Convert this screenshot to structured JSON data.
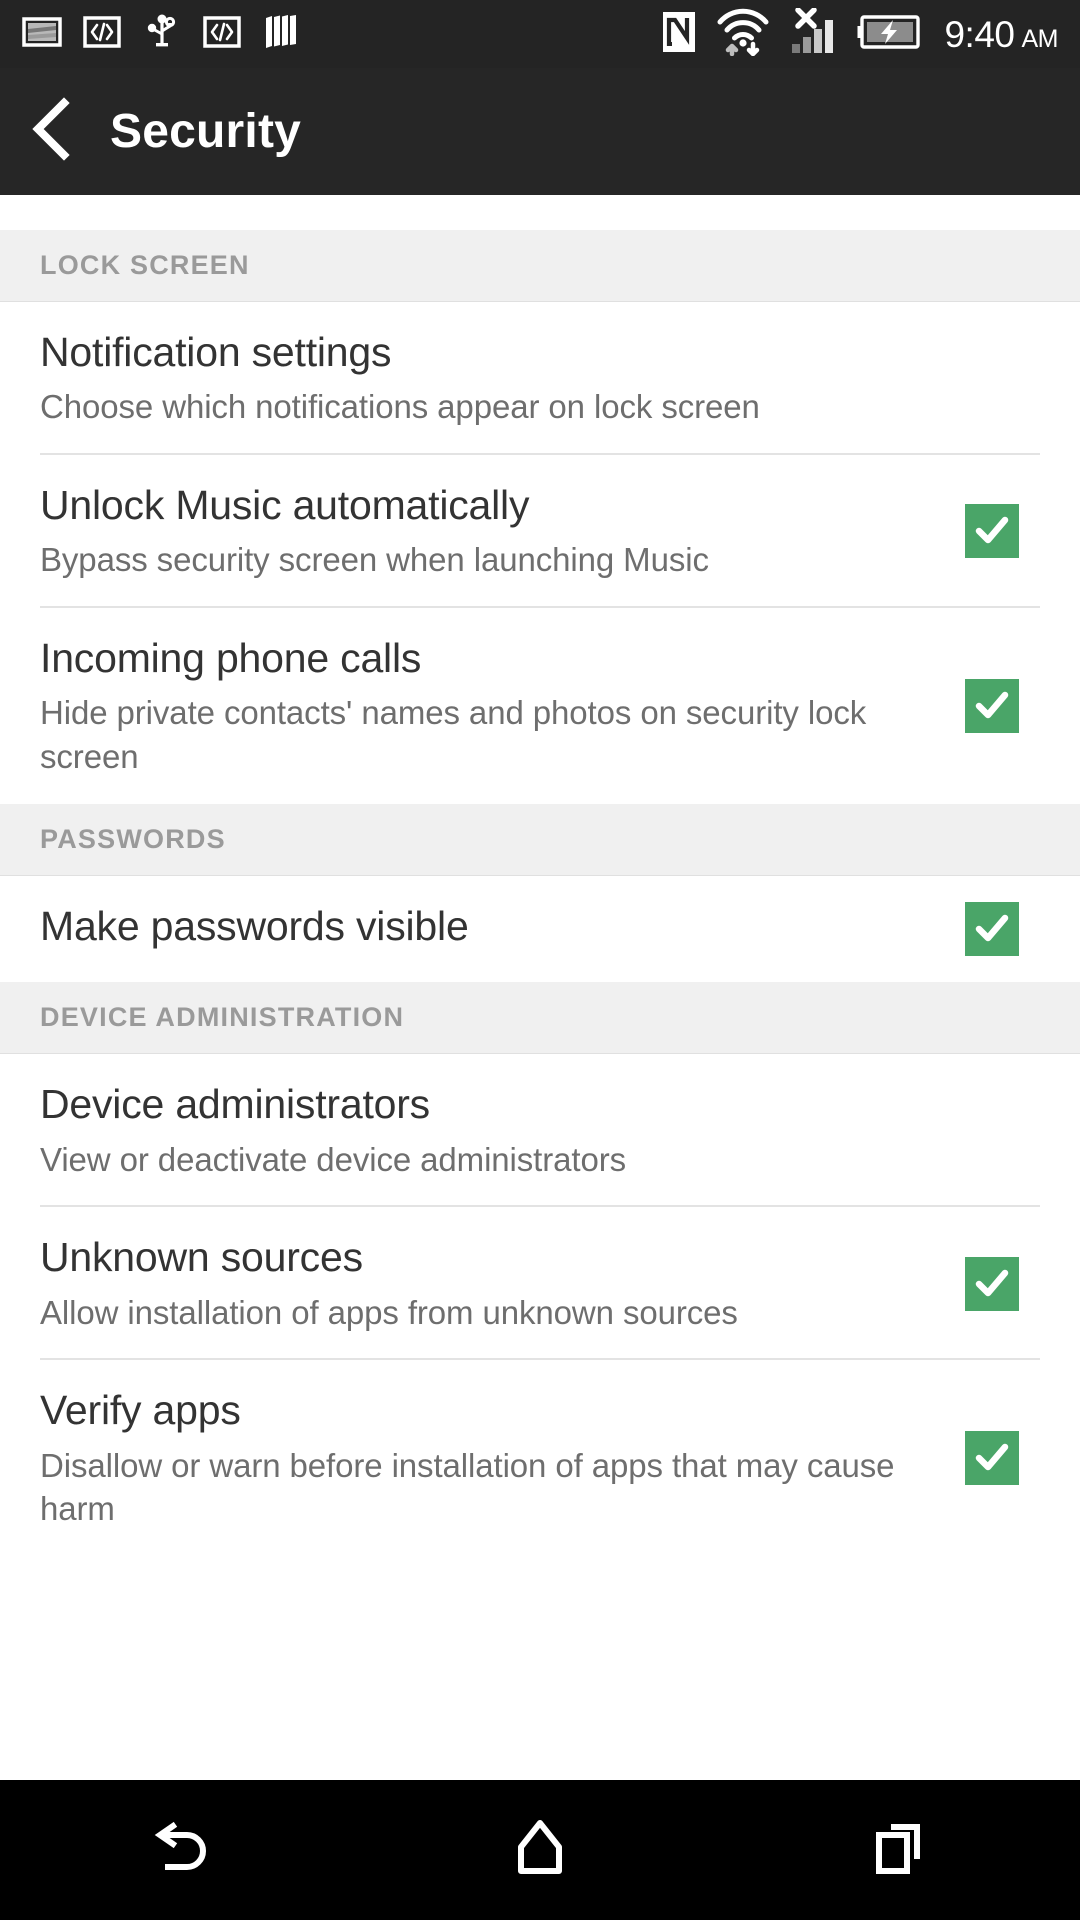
{
  "status_bar": {
    "left_icons": [
      "screenshot-icon",
      "code-brackets-icon",
      "usb-icon",
      "code-brackets-icon-2",
      "columns-icon"
    ],
    "right_icons": [
      "nfc-icon",
      "wifi-transfer-icon",
      "signal-no-service-icon",
      "battery-charging-icon"
    ],
    "time": "9:40",
    "ampm": "AM"
  },
  "action_bar": {
    "back_icon": "back-chevron-icon",
    "title": "Security"
  },
  "colors": {
    "checkbox_green": "#4aa568",
    "action_bar": "#262626",
    "section_header_bg": "#f0f0f0",
    "section_header_text": "#9a9a9a"
  },
  "sections": [
    {
      "header": "LOCK SCREEN",
      "rows": [
        {
          "title": "Notification settings",
          "summary": "Choose which notifications appear on lock screen",
          "checkbox": false,
          "checked": false
        },
        {
          "title": "Unlock Music automatically",
          "summary": "Bypass security screen when launching Music",
          "checkbox": true,
          "checked": true
        },
        {
          "title": "Incoming phone calls",
          "summary": "Hide private contacts' names and photos on security lock screen",
          "checkbox": true,
          "checked": true
        }
      ]
    },
    {
      "header": "PASSWORDS",
      "rows": [
        {
          "title": "Make passwords visible",
          "summary": "",
          "checkbox": true,
          "checked": true
        }
      ]
    },
    {
      "header": "DEVICE ADMINISTRATION",
      "rows": [
        {
          "title": "Device administrators",
          "summary": "View or deactivate device administrators",
          "checkbox": false,
          "checked": false
        },
        {
          "title": "Unknown sources",
          "summary": "Allow installation of apps from unknown sources",
          "checkbox": true,
          "checked": true
        },
        {
          "title": "Verify apps",
          "summary": "Disallow or warn before installation of apps that may cause harm",
          "checkbox": true,
          "checked": true
        }
      ]
    }
  ],
  "nav_bar": {
    "back_label": "back-nav-icon",
    "home_label": "home-nav-icon",
    "recents_label": "recents-nav-icon"
  }
}
